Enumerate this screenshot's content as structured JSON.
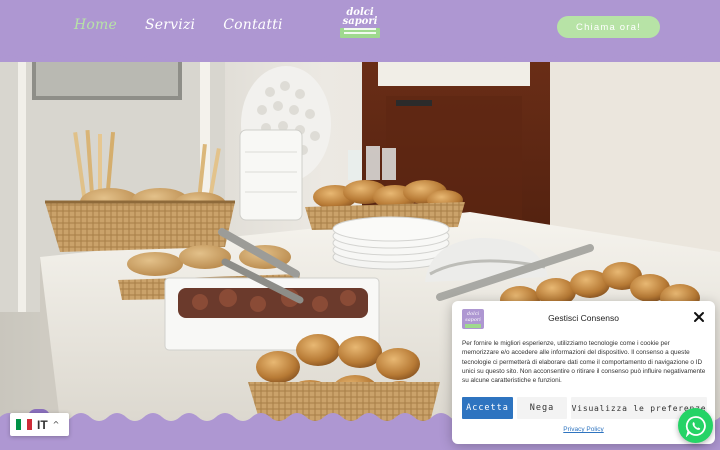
{
  "nav": {
    "items": [
      {
        "label": "Home",
        "active": true
      },
      {
        "label": "Servizi",
        "active": false
      },
      {
        "label": "Contatti",
        "active": false
      }
    ]
  },
  "logo": {
    "line1": "dolci",
    "line2": "sapori"
  },
  "header": {
    "cta_label": "Chiama ora!"
  },
  "colors": {
    "brand_lilac": "#ae97d2",
    "brand_green": "#b7e3a6",
    "accept_blue": "#2e74c0",
    "whatsapp_green": "#25d366"
  },
  "language": {
    "code": "IT",
    "flag": "italy-flag"
  },
  "consent": {
    "title": "Gestisci Consenso",
    "body": "Per fornire le migliori esperienze, utilizziamo tecnologie come i cookie per memorizzare e/o accedere alle informazioni del dispositivo. Il consenso a queste tecnologie ci permetterà di elaborare dati come il comportamento di navigazione o ID unici su questo sito. Non acconsentire o ritirare il consenso può influire negativamente su alcune caratteristiche e funzioni.",
    "accept_label": "Accetta",
    "deny_label": "Nega",
    "preferences_label": "Visualizza le preferenze",
    "policy_label": "Privacy Policy"
  },
  "icons": {
    "close": "close-icon",
    "whatsapp": "whatsapp-icon",
    "language_caret": "chevron-up-icon"
  }
}
